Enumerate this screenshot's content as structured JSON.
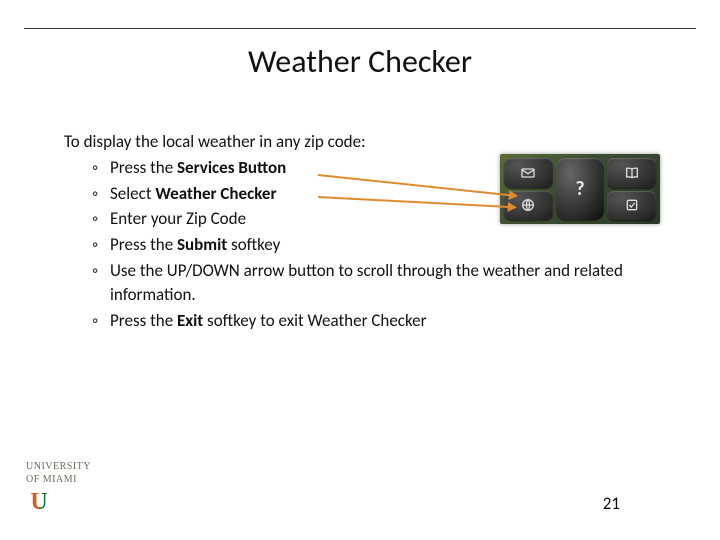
{
  "title": "Weather Checker",
  "intro": "To display the local weather in any zip code:",
  "bullets": [
    {
      "pre": "Press the ",
      "bold": "Services Button",
      "post": ""
    },
    {
      "pre": "Select ",
      "bold": "Weather Checker",
      "post": ""
    },
    {
      "pre": "Enter your Zip Code",
      "bold": "",
      "post": ""
    },
    {
      "pre": "Press the ",
      "bold": "Submit",
      "post": " softkey"
    },
    {
      "pre": "Use the UP/DOWN arrow button to scroll through the weather and related information.",
      "bold": "",
      "post": ""
    },
    {
      "pre": "Press the ",
      "bold": "Exit",
      "post": " softkey to exit Weather Checker"
    }
  ],
  "phone_keys": {
    "top_left": "envelope-icon",
    "top_right": "book-icon",
    "center": "?",
    "bottom_left": "globe-icon",
    "bottom_right": "checkbox-icon"
  },
  "logo": {
    "line1": "UNIVERSITY",
    "line2": "OF MIAMI",
    "mark": "U"
  },
  "page_number": "21"
}
